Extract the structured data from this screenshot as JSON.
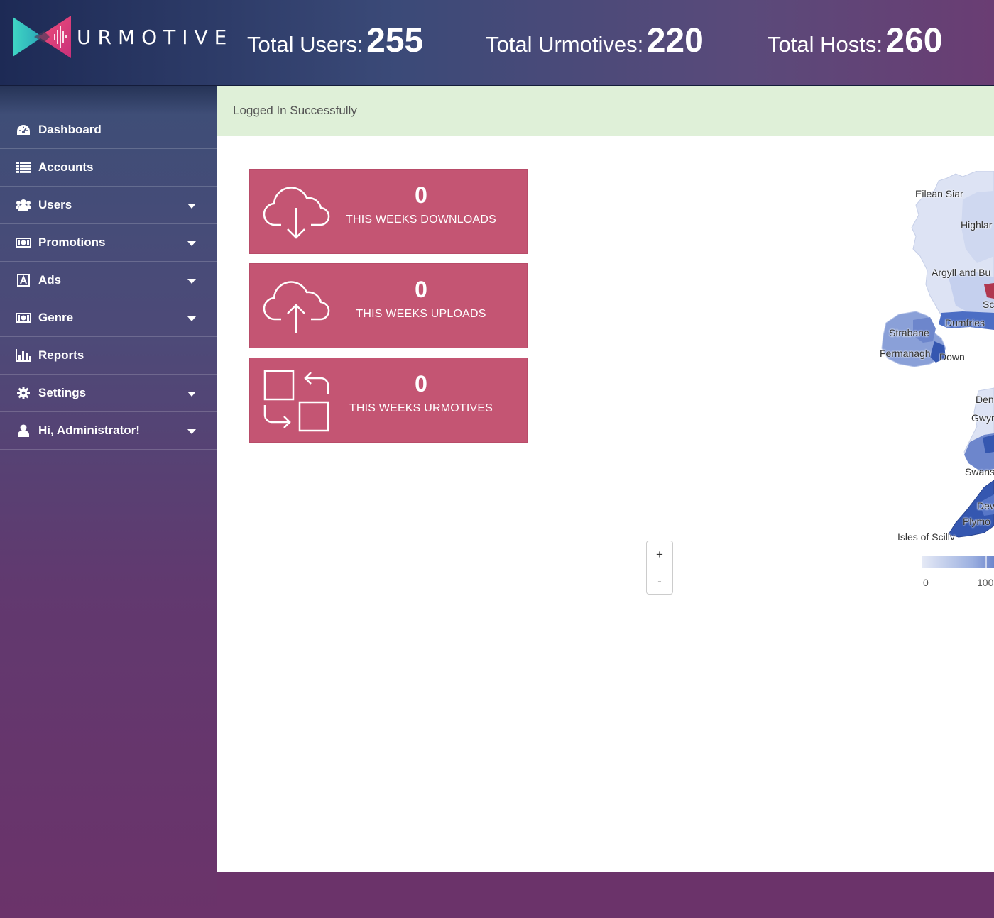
{
  "header": {
    "brand": "URMOTIVE",
    "stats": [
      {
        "label": "Total Users:",
        "value": "255"
      },
      {
        "label": "Total Urmotives:",
        "value": "220"
      },
      {
        "label": "Total Hosts:",
        "value": "260"
      }
    ]
  },
  "sidebar": {
    "items": [
      {
        "label": "Dashboard",
        "icon": "dashboard-icon",
        "has_caret": false
      },
      {
        "label": "Accounts",
        "icon": "list-icon",
        "has_caret": false
      },
      {
        "label": "Users",
        "icon": "users-icon",
        "has_caret": true
      },
      {
        "label": "Promotions",
        "icon": "money-icon",
        "has_caret": true
      },
      {
        "label": "Ads",
        "icon": "ad-icon",
        "has_caret": true
      },
      {
        "label": "Genre",
        "icon": "money-icon",
        "has_caret": true
      },
      {
        "label": "Reports",
        "icon": "bar-chart-icon",
        "has_caret": false
      },
      {
        "label": "Settings",
        "icon": "gear-icon",
        "has_caret": true
      },
      {
        "label": "Hi, Administrator!",
        "icon": "user-icon",
        "has_caret": true
      }
    ]
  },
  "alert": {
    "text": "Logged In Successfully"
  },
  "cards": [
    {
      "value": "0",
      "label": "THIS WEEKS DOWNLOADS",
      "icon": "cloud-download-icon"
    },
    {
      "value": "0",
      "label": "THIS WEEKS UPLOADS",
      "icon": "cloud-upload-icon"
    },
    {
      "value": "0",
      "label": "THIS WEEKS URMOTIVES",
      "icon": "swap-squares-icon"
    }
  ],
  "map": {
    "zoom_in": "+",
    "zoom_out": "-",
    "labels": [
      "Eilean Siar",
      "Highlar",
      "Argyll and Bu",
      "Sc",
      "Dumfries",
      "Strabane",
      "Fermanagh",
      "Down",
      "Den",
      "Gwyr",
      "Swans",
      "Dev",
      "Plymo",
      "Isles of Scilly"
    ],
    "legend": {
      "min": "0",
      "mid": "100"
    },
    "colors": {
      "light": "#dde3f4",
      "mid": "#9cb0e0",
      "dark": "#3557b0"
    }
  },
  "colors": {
    "card": "#c45573",
    "alert_bg": "#dff0d8"
  }
}
